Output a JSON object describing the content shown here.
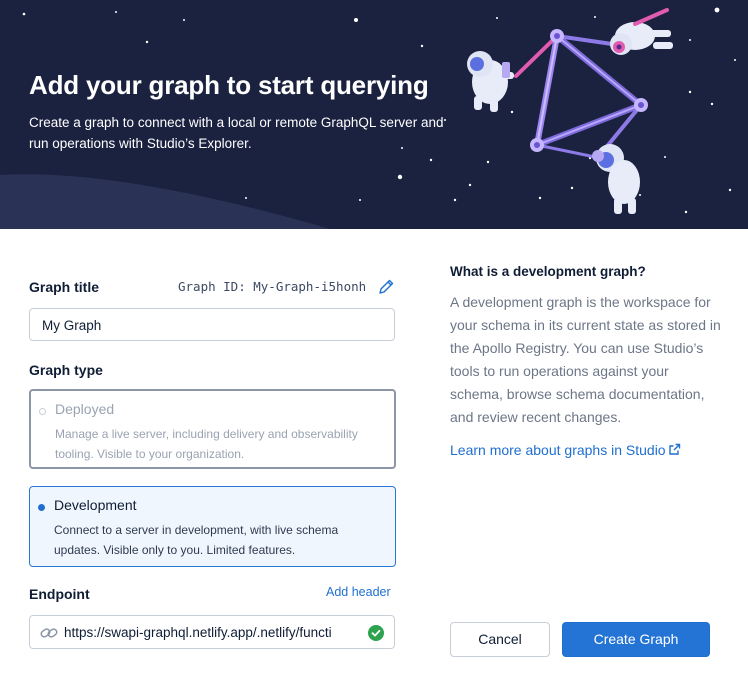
{
  "hero": {
    "title": "Add your graph to start querying",
    "subtitle": "Create a graph to connect with a local or remote GraphQL server and run operations with Studio’s Explorer."
  },
  "form": {
    "graph_title_label": "Graph title",
    "graph_id_text": "Graph ID: My-Graph-i5honh",
    "graph_title_value": "My Graph",
    "graph_type_label": "Graph type",
    "options": [
      {
        "title": "Deployed",
        "description": "Manage a live server, including delivery and observability tooling. Visible to your organization.",
        "selected": false
      },
      {
        "title": "Development",
        "description": "Connect to a server in development, with live schema updates. Visible only to you. Limited features.",
        "selected": true
      }
    ],
    "endpoint_label": "Endpoint",
    "add_header_label": "Add header",
    "endpoint_value": "https://swapi-graphql.netlify.app/.netlify/functi"
  },
  "sidebar": {
    "title": "What is a development graph?",
    "body": "A development graph is the workspace for your schema in its current state as stored in the Apollo Registry. You can use Studio’s tools to run operations against your schema, browse schema documentation, and review recent changes.",
    "link_label": "Learn more about graphs in Studio"
  },
  "actions": {
    "cancel_label": "Cancel",
    "create_label": "Create Graph"
  },
  "colors": {
    "hero_bg": "#1b2240",
    "accent": "#2474d6",
    "success": "#2ea34f"
  },
  "icons": [
    "pencil-icon",
    "link-icon",
    "check-circle-icon",
    "external-link-icon",
    "radio-icon",
    "astronaut-illustration"
  ]
}
